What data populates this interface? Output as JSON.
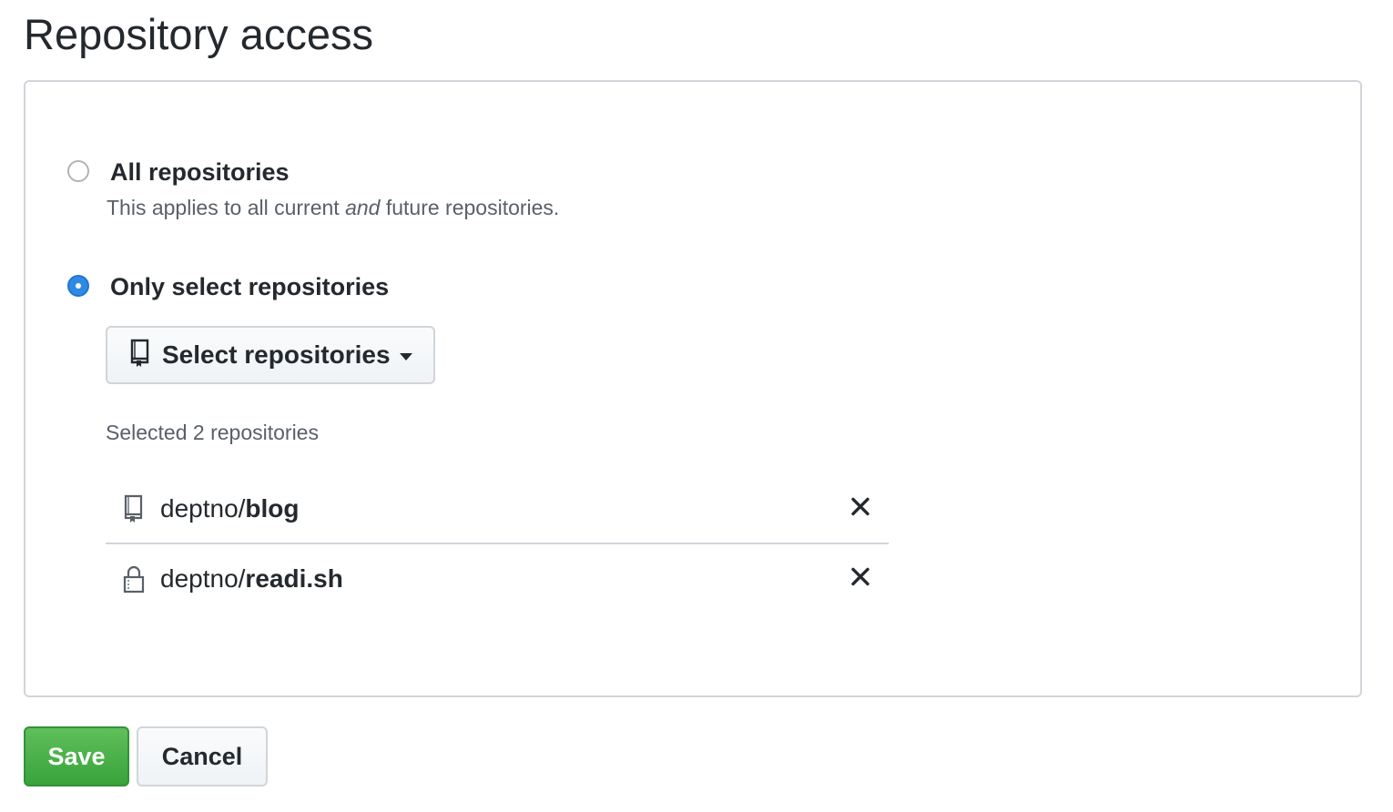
{
  "page": {
    "title": "Repository access"
  },
  "options": {
    "all": {
      "label": "All repositories",
      "note_prefix": "This applies to all current ",
      "note_emphasis": "and",
      "note_suffix": " future repositories.",
      "selected": false
    },
    "select": {
      "label": "Only select repositories",
      "selected": true
    }
  },
  "select_button": {
    "label": "Select repositories",
    "icon": "repo-icon"
  },
  "selected_summary": "Selected 2 repositories",
  "repositories": [
    {
      "owner": "deptno",
      "separator": "/",
      "name": "blog",
      "icon": "repo-icon",
      "remove_icon": "close-icon"
    },
    {
      "owner": "deptno",
      "separator": "/",
      "name": "readi.sh",
      "icon": "lock-icon",
      "remove_icon": "close-icon"
    }
  ],
  "actions": {
    "save_label": "Save",
    "cancel_label": "Cancel"
  },
  "colors": {
    "accent_blue": "#2f8ae6",
    "save_green": "#39a33b",
    "border": "#d1d5da",
    "muted_text": "#586069"
  }
}
